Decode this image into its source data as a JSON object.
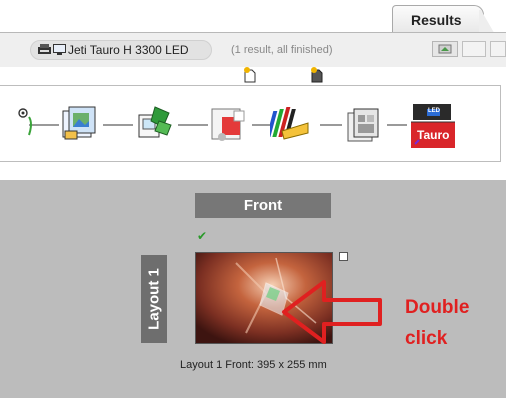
{
  "tabs": {
    "results_label": "Results"
  },
  "printer_bar": {
    "printer_name": "Jeti Tauro H 3300 LED",
    "status_text": "(1 result, all finished)"
  },
  "workflow": {
    "steps": [
      {
        "icon": "start-node-icon"
      },
      {
        "icon": "layout-images-icon"
      },
      {
        "icon": "package-green-icon"
      },
      {
        "icon": "color-shapes-icon"
      },
      {
        "icon": "color-bars-icon"
      },
      {
        "icon": "layout-pages-icon"
      },
      {
        "icon": "printer-tauro-icon",
        "label": "Tauro",
        "badge": "LED"
      }
    ]
  },
  "layout": {
    "side_header": "Front",
    "row_label": "Layout 1",
    "caption": "Layout 1 Front: 395 x 255 mm"
  },
  "annotation": {
    "line1": "Double",
    "line2": "click",
    "color": "#e02020"
  }
}
